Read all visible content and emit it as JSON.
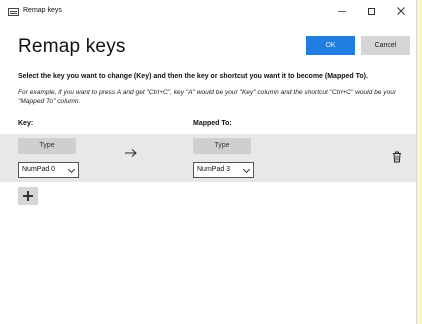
{
  "window": {
    "title": "Remap keys",
    "controls": [
      "minimize",
      "maximize",
      "close"
    ]
  },
  "header": {
    "heading": "Remap keys",
    "ok_label": "OK",
    "cancel_label": "Cancel",
    "ok_color": "#1f7ee0"
  },
  "instructions": {
    "main": "Select the key you want to change (Key) and then the key or shortcut you want it to become (Mapped To).",
    "example": "For example, if you want to press A and get \"Ctrl+C\", key \"A\" would be your \"Key\" column and the shortcut \"Ctrl+C\" would be your \"Mapped To\" column."
  },
  "columns": {
    "key": "Key:",
    "mapped": "Mapped To:"
  },
  "mapping_row": {
    "key_type_label": "Type",
    "key_value": "NumPad 0",
    "mapped_type_label": "Type",
    "mapped_value": "NumPad 3",
    "arrow_icon": "right-arrow-icon",
    "delete_icon": "trash-icon"
  },
  "add_icon": "plus-icon"
}
